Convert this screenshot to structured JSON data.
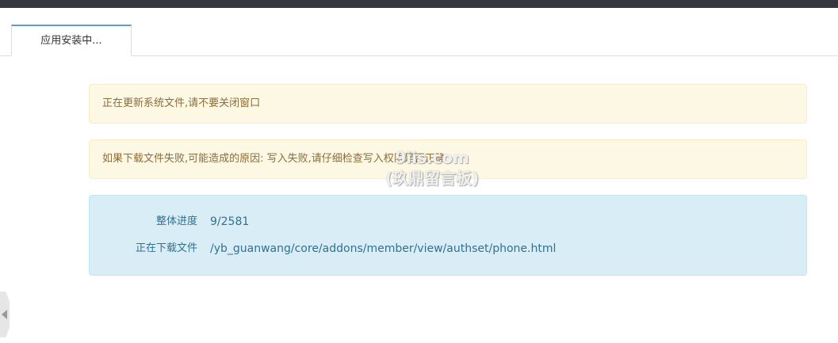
{
  "tabs": [
    {
      "label": "应用安装中..."
    }
  ],
  "alerts": {
    "updating": "正在更新系统文件,请不要关闭窗口",
    "failure_hint": "如果下载文件失败,可能造成的原因: 写入失败,请仔细检查写入权限是否正确"
  },
  "progress": {
    "overall_label": "整体进度",
    "overall_value": "9/2581",
    "downloading_label": "正在下载文件",
    "downloading_value": "/yb_guanwang/core/addons/member/view/authset/phone.html"
  },
  "watermark": {
    "line1": "9iis.com",
    "line2": "(玖鼎留言板)"
  },
  "icons": {
    "side_handle": "caret-left-icon"
  },
  "colors": {
    "topbar": "#34383e",
    "tab_accent": "#5f9ad0",
    "warning_bg": "#fcf8e3",
    "warning_text": "#8a6d3b",
    "info_bg": "#d9edf7",
    "info_text": "#31708f"
  }
}
